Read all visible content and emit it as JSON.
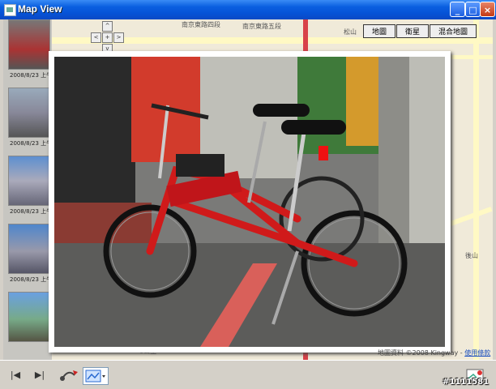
{
  "window": {
    "title": "Map View",
    "minimize_label": "_",
    "maximize_label": "□",
    "close_label": "×"
  },
  "sidebar": {
    "dates": [
      "2008/8/23 上午",
      "2008/8/23 上午",
      "2008/8/23 上午",
      "2008/8/23 上午"
    ]
  },
  "map": {
    "tabs": [
      "地圖",
      "衛星",
      "混合地圖"
    ],
    "labels": {
      "street1": "南京東路四段",
      "street2": "南京東路五段",
      "district1": "松山",
      "district2": "後山",
      "bottom": "1公里"
    },
    "nav": {
      "up": "^",
      "left": "<",
      "center": "+",
      "right": ">",
      "down": "v"
    },
    "attribution_text": "地圖資料 ©2008 Kingway - ",
    "attribution_link": "使用條款"
  },
  "toolbar": {
    "prev_label": "|◀",
    "next_label": "▶|"
  },
  "watermark": "#1111581",
  "colors": {
    "titlebar": "#0652d6",
    "close_button": "#c43a14",
    "map_background": "#f0ead9",
    "bike_red": "#d01a1a"
  }
}
